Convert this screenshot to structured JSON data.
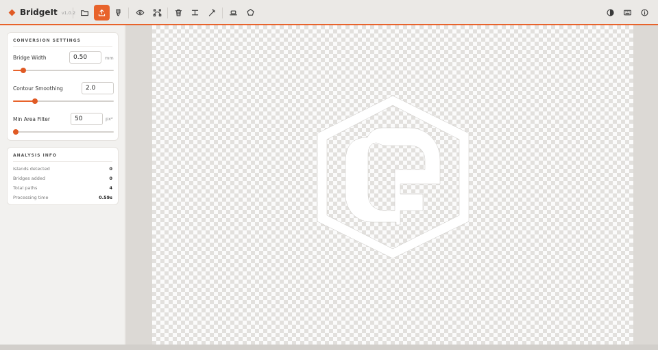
{
  "app": {
    "name": "BridgeIt",
    "version": "v1.0.2"
  },
  "toolbar": {
    "tools": [
      {
        "id": "open",
        "icon": "folder-icon",
        "tooltip": ""
      },
      {
        "id": "export",
        "icon": "upload-icon",
        "active": true
      },
      {
        "id": "paint",
        "icon": "marker-icon"
      },
      {
        "id": "preview",
        "icon": "eye-icon"
      },
      {
        "id": "path",
        "icon": "bezier-icon"
      },
      {
        "id": "delete",
        "icon": "trash-icon"
      },
      {
        "id": "bridge",
        "icon": "i-beam-icon"
      },
      {
        "id": "magic",
        "icon": "wand-icon"
      },
      {
        "id": "frame",
        "icon": "frame-icon"
      },
      {
        "id": "polygon",
        "icon": "polygon-icon"
      }
    ],
    "right_tools": [
      {
        "id": "theme",
        "icon": "contrast-icon"
      },
      {
        "id": "shortcuts",
        "icon": "keyboard-icon"
      },
      {
        "id": "about",
        "icon": "info-icon"
      }
    ],
    "accent_color": "#e8632b"
  },
  "settings": {
    "title": "CONVERSION SETTINGS",
    "bridge_width": {
      "label": "Bridge Width",
      "value": "0.50",
      "unit": "mm",
      "slider": 0.1
    },
    "contour_smoothing": {
      "label": "Contour Smoothing",
      "value": "2.0",
      "slider": 0.22
    },
    "min_area_filter": {
      "label": "Min Area Filter",
      "value": "50",
      "unit": "px²",
      "slider": 0.03
    }
  },
  "analysis": {
    "title": "ANALYSIS INFO",
    "rows": [
      {
        "label": "Islands detected",
        "value": "0"
      },
      {
        "label": "Bridges added",
        "value": "0"
      },
      {
        "label": "Total paths",
        "value": "4"
      },
      {
        "label": "Processing time",
        "value": "0.59s"
      }
    ]
  }
}
